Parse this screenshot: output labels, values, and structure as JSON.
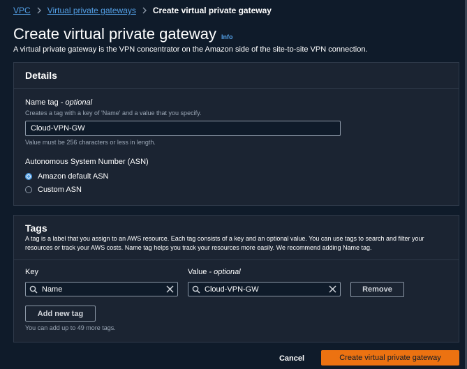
{
  "breadcrumb": {
    "items": [
      "VPC",
      "Virtual private gateways"
    ],
    "current": "Create virtual private gateway"
  },
  "header": {
    "title": "Create virtual private gateway",
    "info": "Info",
    "description": "A virtual private gateway is the VPN concentrator on the Amazon side of the site-to-site VPN connection."
  },
  "details": {
    "title": "Details",
    "name_tag_label": "Name tag",
    "name_tag_optional": "- optional",
    "name_tag_hint": "Creates a tag with a key of 'Name' and a value that you specify.",
    "name_tag_value": "Cloud-VPN-GW",
    "name_tag_constraint": "Value must be 256 characters or less in length.",
    "asn_label": "Autonomous System Number (ASN)",
    "asn_options": [
      {
        "label": "Amazon default ASN",
        "selected": true
      },
      {
        "label": "Custom ASN",
        "selected": false
      }
    ]
  },
  "tags": {
    "title": "Tags",
    "description": "A tag is a label that you assign to an AWS resource. Each tag consists of a key and an optional value. You can use tags to search and filter your resources or track your AWS costs. Name tag helps you track your resources more easily. We recommend adding Name tag.",
    "key_label": "Key",
    "value_label": "Value",
    "value_optional": "- optional",
    "rows": [
      {
        "key": "Name",
        "value": "Cloud-VPN-GW"
      }
    ],
    "remove_label": "Remove",
    "add_label": "Add new tag",
    "limit_hint": "You can add up to 49 more tags."
  },
  "footer": {
    "cancel": "Cancel",
    "submit": "Create virtual private gateway"
  },
  "colors": {
    "background": "#0f1b2a",
    "panel": "#1b2432",
    "link": "#539fe5",
    "primary": "#ec7211"
  }
}
